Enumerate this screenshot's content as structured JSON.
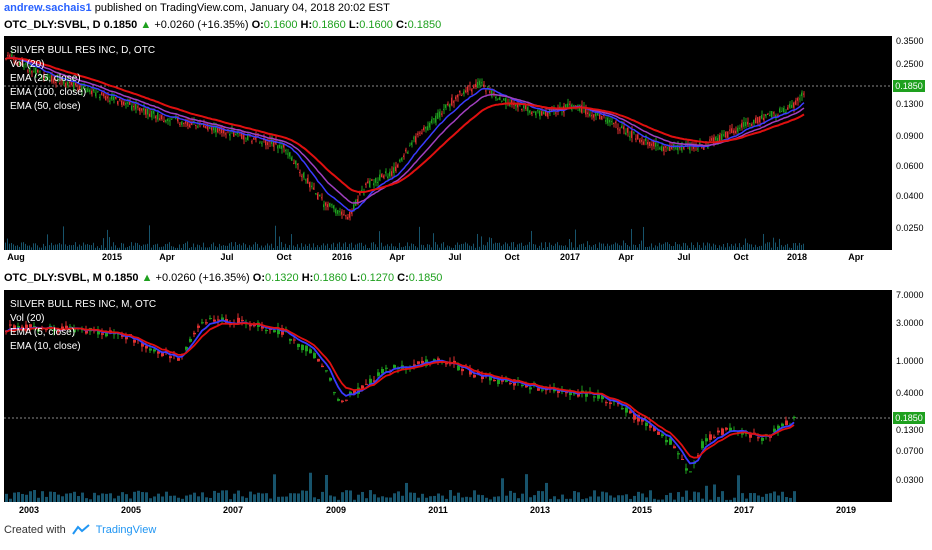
{
  "header1": {
    "user": "andrew.sachais1",
    "published": "published on TradingView.com, January 04, 2018 20:02 EST",
    "symbol": "OTC_DLY:SVBL, D",
    "price": "0.1850",
    "change": "+0.0260 (+16.35%)",
    "o_label": "O:",
    "o": "0.1600",
    "h_label": "H:",
    "h": "0.1860",
    "l_label": "L:",
    "l": "0.1600",
    "c_label": "C:",
    "c": "0.1850"
  },
  "panel1": {
    "title": "SILVER BULL RES INC, D, OTC",
    "indicators": [
      "Vol (20)",
      "EMA (25, close)",
      "EMA (100, close)",
      "EMA (50, close)"
    ],
    "y_ticks": [
      "0.3500",
      "0.2500",
      "0.1850",
      "0.1300",
      "0.0900",
      "0.0600",
      "0.0400",
      "0.0250"
    ],
    "last_price": "0.1850",
    "x_ticks": [
      "Aug",
      "2015",
      "Apr",
      "Jul",
      "Oct",
      "2016",
      "Apr",
      "Jul",
      "Oct",
      "2017",
      "Apr",
      "Jul",
      "Oct",
      "2018",
      "Apr"
    ]
  },
  "header2": {
    "symbol": "OTC_DLY:SVBL, M",
    "price": "0.1850",
    "change": "+0.0260 (+16.35%)",
    "o_label": "O:",
    "o": "0.1320",
    "h_label": "H:",
    "h": "0.1860",
    "l_label": "L:",
    "l": "0.1270",
    "c_label": "C:",
    "c": "0.1850"
  },
  "panel2": {
    "title": "SILVER BULL RES INC, M, OTC",
    "indicators": [
      "Vol (20)",
      "EMA (5, close)",
      "EMA (10, close)"
    ],
    "y_ticks": [
      "7.0000",
      "3.0000",
      "1.0000",
      "0.4000",
      "0.1850",
      "0.1300",
      "0.0700",
      "0.0300"
    ],
    "last_price": "0.1850",
    "x_ticks": [
      "2003",
      "2005",
      "2007",
      "2009",
      "2011",
      "2013",
      "2015",
      "2017",
      "2019"
    ]
  },
  "footer": {
    "created_with": "Created with",
    "brand": "TradingView"
  },
  "colors": {
    "up": "#1ea01e",
    "down": "#e03030",
    "ema_short": "#3a3aff",
    "ema_long": "#e01010",
    "ema_mid": "#a040c0",
    "volume": "#1f6f8f"
  }
}
